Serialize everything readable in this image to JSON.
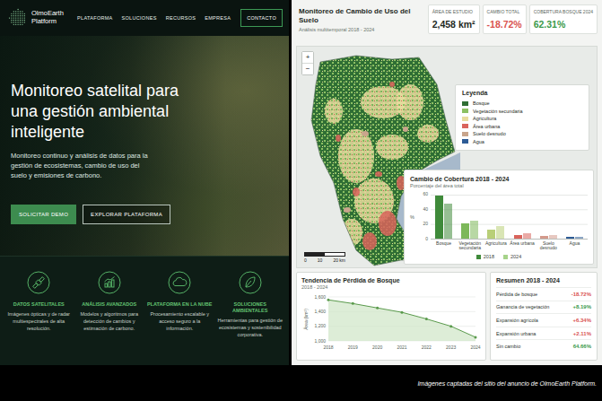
{
  "website": {
    "logo": {
      "name": "OlmoEarth",
      "suffix": "Platform"
    },
    "nav": [
      "PLATAFORMA",
      "SOLUCIONES",
      "RECURSOS",
      "EMPRESA"
    ],
    "contact_button": "CONTACTO",
    "hero": {
      "title": "Monitoreo satelital para una gestión ambiental inteligente",
      "text": "Monitoreo continuo y análisis de datos para la gestión de ecosistemas, cambio de uso del suelo y emisiones de carbono.",
      "buttons": [
        {
          "label": "SOLICITAR DEMO",
          "kind": "primary"
        },
        {
          "label": "EXPLORAR PLATAFORMA",
          "kind": "outline"
        }
      ]
    },
    "features": [
      {
        "title": "DATOS SATELITALES",
        "text": "Imágenes ópticas y de radar multiespectrales de alta resolución."
      },
      {
        "title": "ANÁLISIS AVANZADOS",
        "text": "Modelos y algoritmos para detección de cambios y estimación de carbono."
      },
      {
        "title": "PLATAFORMA EN LA NUBE",
        "text": "Procesamiento escalable y acceso seguro a la información."
      },
      {
        "title": "SOLUCIONES AMBIENTALES",
        "text": "Herramientas para gestión de ecosistemas y sostenibilidad corporativa."
      }
    ]
  },
  "dashboard": {
    "title": "Monitoreo de Cambio de Uso del Suelo",
    "subtitle": "Análisis multitemporal 2018 - 2024",
    "kpis": [
      {
        "label": "ÁREA DE ESTUDIO",
        "value": "2,458 km²",
        "color": "#1f2a24"
      },
      {
        "label": "CAMBIO TOTAL",
        "value": "-18.72%",
        "color": "#d9534f"
      },
      {
        "label": "COBERTURA BOSQUE 2024",
        "value": "62.31%",
        "color": "#3a9a4a"
      }
    ],
    "map": {
      "zoom": [
        "+",
        "−"
      ],
      "scale": [
        "0",
        "10",
        "20 km"
      ]
    },
    "legend": {
      "title": "Leyenda",
      "items": [
        {
          "label": "Bosque",
          "color": "#2f6e34"
        },
        {
          "label": "Vegetación secundaria",
          "color": "#8cc063"
        },
        {
          "label": "Agricultura",
          "color": "#e9dc9e"
        },
        {
          "label": "Área urbana",
          "color": "#d9645c"
        },
        {
          "label": "Suelo desnudo",
          "color": "#c9a58c"
        },
        {
          "label": "Agua",
          "color": "#2e5c96"
        }
      ]
    },
    "coverage_chart": {
      "title": "Cambio de Cobertura 2018 - 2024",
      "subtitle": "Porcentaje del área total",
      "y_unit": "%",
      "y_ticks": [
        "60",
        "40",
        "20",
        "0"
      ],
      "series": [
        {
          "label": "2018",
          "color": "#3f8a3a"
        },
        {
          "label": "2024",
          "color": "#a6d38a"
        }
      ],
      "categories": [
        {
          "label": "Bosque",
          "color": "#3f8a3a",
          "values": [
            58,
            47
          ]
        },
        {
          "label": "Vegetación secundaria",
          "color": "#7db85a",
          "values": [
            20,
            24
          ]
        },
        {
          "label": "Agricultura",
          "color": "#b9cf78",
          "values": [
            12,
            17
          ]
        },
        {
          "label": "Área urbana",
          "color": "#d9645c",
          "values": [
            4,
            7
          ]
        },
        {
          "label": "Suelo desnudo",
          "color": "#d49a8c",
          "values": [
            3,
            4
          ]
        },
        {
          "label": "Agua",
          "color": "#2e5c96",
          "values": [
            2,
            2
          ]
        }
      ]
    },
    "trend_chart": {
      "title": "Tendencia de Pérdida de Bosque",
      "subtitle": "2018 - 2024",
      "y_label": "Área (km²)",
      "y_ticks": [
        "1,600",
        "1,400",
        "1,200",
        "1,000"
      ],
      "x_labels": [
        "2018",
        "2019",
        "2020",
        "2021",
        "2022",
        "2023",
        "2024"
      ],
      "values": [
        1560,
        1510,
        1450,
        1390,
        1300,
        1200,
        1050
      ]
    },
    "summary": {
      "title": "Resumen 2018 - 2024",
      "rows": [
        {
          "label": "Pérdida de bosque",
          "value": "-18.72%",
          "color": "#d9534f"
        },
        {
          "label": "Ganancia de vegetación",
          "value": "+8.19%",
          "color": "#3a9a4a"
        },
        {
          "label": "Expansión agrícola",
          "value": "+6.34%",
          "color": "#d9534f"
        },
        {
          "label": "Expansión urbana",
          "value": "+2.11%",
          "color": "#d9534f"
        },
        {
          "label": "Sin cambio",
          "value": "64.66%",
          "color": "#3a9a4a"
        }
      ]
    }
  },
  "caption": "Imágenes captadas del sitio del anuncio de OlmoEarth Platform."
}
